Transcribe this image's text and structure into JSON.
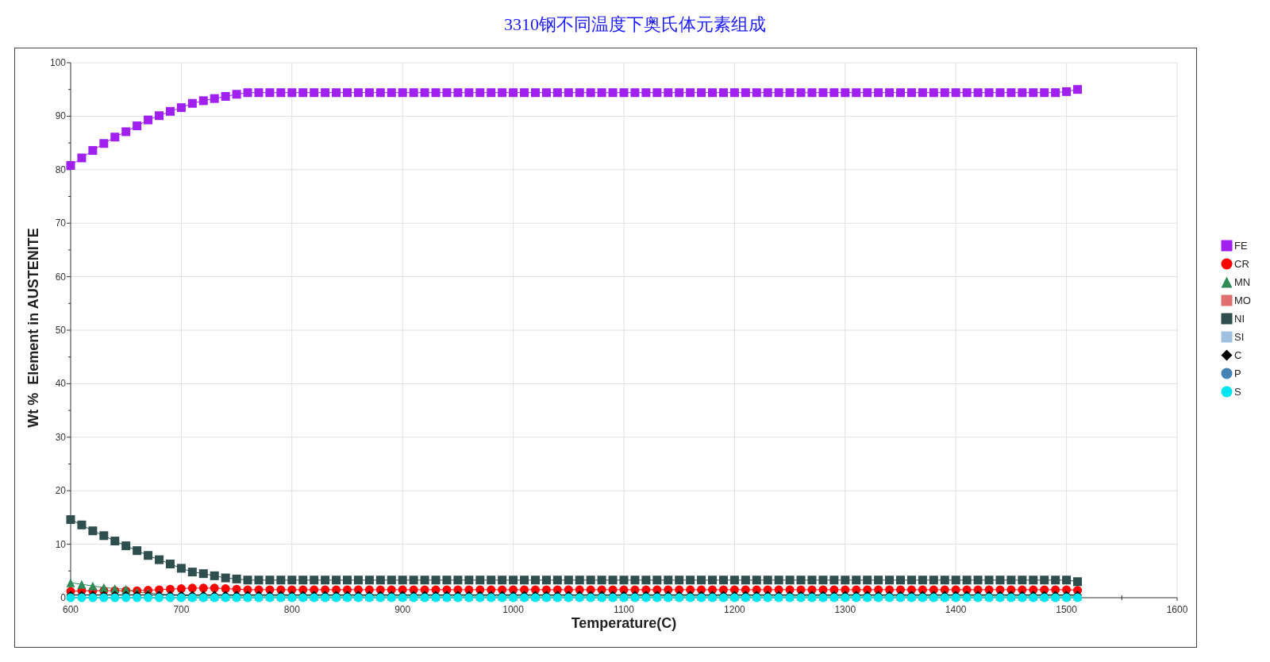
{
  "title": "3310钢不同温度下奥氏体元素组成",
  "chart_data": {
    "type": "line",
    "xlabel": "Temperature(C)",
    "ylabel": "Wt %  Element in AUSTENITE",
    "grid": true,
    "x": [
      600,
      610,
      620,
      630,
      640,
      650,
      660,
      670,
      680,
      690,
      700,
      710,
      720,
      730,
      740,
      750,
      760,
      770,
      780,
      790,
      800,
      810,
      820,
      830,
      840,
      850,
      860,
      870,
      880,
      890,
      900,
      910,
      920,
      930,
      940,
      950,
      960,
      970,
      980,
      990,
      1000,
      1010,
      1020,
      1030,
      1040,
      1050,
      1060,
      1070,
      1080,
      1090,
      1100,
      1110,
      1120,
      1130,
      1140,
      1150,
      1160,
      1170,
      1180,
      1190,
      1200,
      1210,
      1220,
      1230,
      1240,
      1250,
      1260,
      1270,
      1280,
      1290,
      1300,
      1310,
      1320,
      1330,
      1340,
      1350,
      1360,
      1370,
      1380,
      1390,
      1400,
      1410,
      1420,
      1430,
      1440,
      1450,
      1460,
      1470,
      1480,
      1490,
      1500,
      1510
    ],
    "xlim": [
      600,
      1600
    ],
    "ylim": [
      0,
      100
    ],
    "xticks": [
      600,
      700,
      800,
      900,
      1000,
      1100,
      1200,
      1300,
      1400,
      1500,
      1600
    ],
    "yticks": [
      0,
      10,
      20,
      30,
      40,
      50,
      60,
      70,
      80,
      90,
      100
    ],
    "series": [
      {
        "name": "FE",
        "color": "#a020f0",
        "marker": "square",
        "values": [
          80.8,
          82.2,
          83.6,
          84.9,
          86.1,
          87.1,
          88.2,
          89.3,
          90.1,
          90.9,
          91.6,
          92.4,
          92.9,
          93.3,
          93.7,
          94.1,
          94.4,
          94.4,
          94.4,
          94.4,
          94.4,
          94.4,
          94.4,
          94.4,
          94.4,
          94.4,
          94.4,
          94.4,
          94.4,
          94.4,
          94.4,
          94.4,
          94.4,
          94.4,
          94.4,
          94.4,
          94.4,
          94.4,
          94.4,
          94.4,
          94.4,
          94.4,
          94.4,
          94.4,
          94.4,
          94.4,
          94.4,
          94.4,
          94.4,
          94.4,
          94.4,
          94.4,
          94.4,
          94.4,
          94.4,
          94.4,
          94.4,
          94.4,
          94.4,
          94.4,
          94.4,
          94.4,
          94.4,
          94.4,
          94.4,
          94.4,
          94.4,
          94.4,
          94.4,
          94.4,
          94.4,
          94.4,
          94.4,
          94.4,
          94.4,
          94.4,
          94.4,
          94.4,
          94.4,
          94.4,
          94.4,
          94.4,
          94.4,
          94.4,
          94.4,
          94.4,
          94.4,
          94.4,
          94.4,
          94.4,
          94.6,
          95.0
        ]
      },
      {
        "name": "CR",
        "color": "#ff0000",
        "marker": "circle",
        "values": [
          1.2,
          1.3,
          1.3,
          1.3,
          1.3,
          1.3,
          1.3,
          1.4,
          1.5,
          1.6,
          1.7,
          1.8,
          1.8,
          1.8,
          1.7,
          1.6,
          1.5,
          1.5,
          1.5,
          1.5,
          1.5,
          1.5,
          1.5,
          1.5,
          1.5,
          1.5,
          1.5,
          1.5,
          1.5,
          1.5,
          1.5,
          1.5,
          1.5,
          1.5,
          1.5,
          1.5,
          1.5,
          1.5,
          1.5,
          1.5,
          1.5,
          1.5,
          1.5,
          1.5,
          1.5,
          1.5,
          1.5,
          1.5,
          1.5,
          1.5,
          1.5,
          1.5,
          1.5,
          1.5,
          1.5,
          1.5,
          1.5,
          1.5,
          1.5,
          1.5,
          1.5,
          1.5,
          1.5,
          1.5,
          1.5,
          1.5,
          1.5,
          1.5,
          1.5,
          1.5,
          1.5,
          1.5,
          1.5,
          1.5,
          1.5,
          1.5,
          1.5,
          1.5,
          1.5,
          1.5,
          1.5,
          1.5,
          1.5,
          1.5,
          1.5,
          1.5,
          1.5,
          1.5,
          1.5,
          1.5,
          1.5,
          1.4
        ]
      },
      {
        "name": "MN",
        "color": "#2e8b57",
        "marker": "triangle",
        "values": [
          2.8,
          2.5,
          2.2,
          1.9,
          1.7,
          1.6,
          1.0,
          0.9,
          0.7,
          0.5,
          0.4,
          0.3,
          0.3,
          0.3,
          0.3,
          0.3,
          0.3,
          0.3,
          0.3,
          0.3,
          0.3,
          0.3,
          0.3,
          0.3,
          0.3,
          0.3,
          0.3,
          0.3,
          0.3,
          0.3,
          0.3,
          0.3,
          0.3,
          0.3,
          0.3,
          0.3,
          0.3,
          0.3,
          0.3,
          0.3,
          0.3,
          0.3,
          0.3,
          0.3,
          0.3,
          0.3,
          0.3,
          0.3,
          0.3,
          0.3,
          0.3,
          0.3,
          0.3,
          0.3,
          0.3,
          0.3,
          0.3,
          0.3,
          0.3,
          0.3,
          0.3,
          0.3,
          0.3,
          0.3,
          0.3,
          0.3,
          0.3,
          0.3,
          0.3,
          0.3,
          0.3,
          0.3,
          0.3,
          0.3,
          0.3,
          0.3,
          0.3,
          0.3,
          0.3,
          0.3,
          0.3,
          0.3,
          0.3,
          0.3,
          0.3,
          0.3,
          0.3,
          0.3,
          0.3,
          0.3,
          0.3,
          0.3
        ]
      },
      {
        "name": "MO",
        "color": "#e07070",
        "marker": "square",
        "values": [
          null,
          null,
          null,
          null,
          null,
          null,
          null,
          null,
          null,
          null,
          null,
          null,
          null,
          null,
          null,
          null,
          null,
          null,
          null,
          null,
          null,
          null,
          null,
          null,
          null,
          null,
          null,
          null,
          null,
          null,
          null,
          null,
          null,
          null,
          null,
          null,
          null,
          null,
          null,
          null,
          null,
          null,
          null,
          null,
          null,
          null,
          null,
          null,
          null,
          null,
          null,
          null,
          null,
          null,
          null,
          null,
          null,
          null,
          null,
          null,
          null,
          null,
          null,
          null,
          null,
          null,
          null,
          null,
          null,
          null,
          null,
          null,
          null,
          null,
          null,
          null,
          null,
          null,
          null,
          null,
          null,
          null,
          null,
          null,
          null,
          null,
          null,
          null,
          null,
          null,
          null,
          null
        ]
      },
      {
        "name": "NI",
        "color": "#2f4f4f",
        "marker": "square",
        "values": [
          14.6,
          13.6,
          12.5,
          11.6,
          10.6,
          9.7,
          8.8,
          7.9,
          7.1,
          6.3,
          5.5,
          4.8,
          4.5,
          4.1,
          3.7,
          3.5,
          3.3,
          3.3,
          3.3,
          3.3,
          3.3,
          3.3,
          3.3,
          3.3,
          3.3,
          3.3,
          3.3,
          3.3,
          3.3,
          3.3,
          3.3,
          3.3,
          3.3,
          3.3,
          3.3,
          3.3,
          3.3,
          3.3,
          3.3,
          3.3,
          3.3,
          3.3,
          3.3,
          3.3,
          3.3,
          3.3,
          3.3,
          3.3,
          3.3,
          3.3,
          3.3,
          3.3,
          3.3,
          3.3,
          3.3,
          3.3,
          3.3,
          3.3,
          3.3,
          3.3,
          3.3,
          3.3,
          3.3,
          3.3,
          3.3,
          3.3,
          3.3,
          3.3,
          3.3,
          3.3,
          3.3,
          3.3,
          3.3,
          3.3,
          3.3,
          3.3,
          3.3,
          3.3,
          3.3,
          3.3,
          3.3,
          3.3,
          3.3,
          3.3,
          3.3,
          3.3,
          3.3,
          3.3,
          3.3,
          3.3,
          3.3,
          3.0
        ]
      },
      {
        "name": "SI",
        "color": "#a0c0e0",
        "marker": "square",
        "values": [
          null,
          null,
          null,
          null,
          null,
          null,
          null,
          null,
          null,
          null,
          null,
          null,
          null,
          null,
          null,
          null,
          null,
          null,
          null,
          null,
          null,
          null,
          null,
          null,
          null,
          null,
          null,
          null,
          null,
          null,
          null,
          null,
          null,
          null,
          null,
          null,
          null,
          null,
          null,
          null,
          null,
          null,
          null,
          null,
          null,
          null,
          null,
          null,
          null,
          null,
          null,
          null,
          null,
          null,
          null,
          null,
          null,
          null,
          null,
          null,
          null,
          null,
          null,
          null,
          null,
          null,
          null,
          null,
          null,
          null,
          null,
          null,
          null,
          null,
          null,
          null,
          null,
          null,
          null,
          null,
          null,
          null,
          null,
          null,
          null,
          null,
          null,
          null,
          null,
          null,
          null,
          null
        ]
      },
      {
        "name": "C",
        "color": "#000000",
        "marker": "diamond",
        "values": [
          0.5,
          0.5,
          0.5,
          0.5,
          0.5,
          0.5,
          0.5,
          0.5,
          0.5,
          0.5,
          0.5,
          0.5,
          0.5,
          0.5,
          0.5,
          0.5,
          0.5,
          0.5,
          0.5,
          0.5,
          0.5,
          0.5,
          0.5,
          0.5,
          0.5,
          0.5,
          0.5,
          0.5,
          0.5,
          0.5,
          0.5,
          0.5,
          0.5,
          0.5,
          0.5,
          0.5,
          0.5,
          0.5,
          0.5,
          0.5,
          0.5,
          0.5,
          0.5,
          0.5,
          0.5,
          0.5,
          0.5,
          0.5,
          0.5,
          0.5,
          0.5,
          0.5,
          0.5,
          0.5,
          0.5,
          0.5,
          0.5,
          0.5,
          0.5,
          0.5,
          0.5,
          0.5,
          0.5,
          0.5,
          0.5,
          0.5,
          0.5,
          0.5,
          0.5,
          0.5,
          0.5,
          0.5,
          0.5,
          0.5,
          0.5,
          0.5,
          0.5,
          0.5,
          0.5,
          0.5,
          0.5,
          0.5,
          0.5,
          0.5,
          0.5,
          0.5,
          0.5,
          0.5,
          0.5,
          0.5,
          0.5,
          0.5
        ]
      },
      {
        "name": "P",
        "color": "#4682b4",
        "marker": "circle",
        "values": [
          null,
          null,
          null,
          null,
          null,
          null,
          null,
          null,
          null,
          null,
          null,
          null,
          null,
          null,
          null,
          null,
          null,
          null,
          null,
          null,
          null,
          null,
          null,
          null,
          null,
          null,
          null,
          null,
          null,
          null,
          null,
          null,
          null,
          null,
          null,
          null,
          null,
          null,
          null,
          null,
          null,
          null,
          null,
          null,
          null,
          null,
          null,
          null,
          null,
          null,
          null,
          null,
          null,
          null,
          null,
          null,
          null,
          null,
          null,
          null,
          null,
          null,
          null,
          null,
          null,
          null,
          null,
          null,
          null,
          null,
          null,
          null,
          null,
          null,
          null,
          null,
          null,
          null,
          null,
          null,
          null,
          null,
          null,
          null,
          null,
          null,
          null,
          null,
          null,
          null,
          null,
          null
        ]
      },
      {
        "name": "S",
        "color": "#00e5ee",
        "marker": "circle",
        "values": [
          0,
          0,
          0,
          0,
          0,
          0,
          0,
          0,
          0,
          0,
          0,
          0,
          0,
          0,
          0,
          0,
          0,
          0,
          0,
          0,
          0,
          0,
          0,
          0,
          0,
          0,
          0,
          0,
          0,
          0,
          0,
          0,
          0,
          0,
          0,
          0,
          0,
          0,
          0,
          0,
          0,
          0,
          0,
          0,
          0,
          0,
          0,
          0,
          0,
          0,
          0,
          0,
          0,
          0,
          0,
          0,
          0,
          0,
          0,
          0,
          0,
          0,
          0,
          0,
          0,
          0,
          0,
          0,
          0,
          0,
          0,
          0,
          0,
          0,
          0,
          0,
          0,
          0,
          0,
          0,
          0,
          0,
          0,
          0,
          0,
          0,
          0,
          0,
          0,
          0,
          0,
          0
        ]
      }
    ]
  }
}
